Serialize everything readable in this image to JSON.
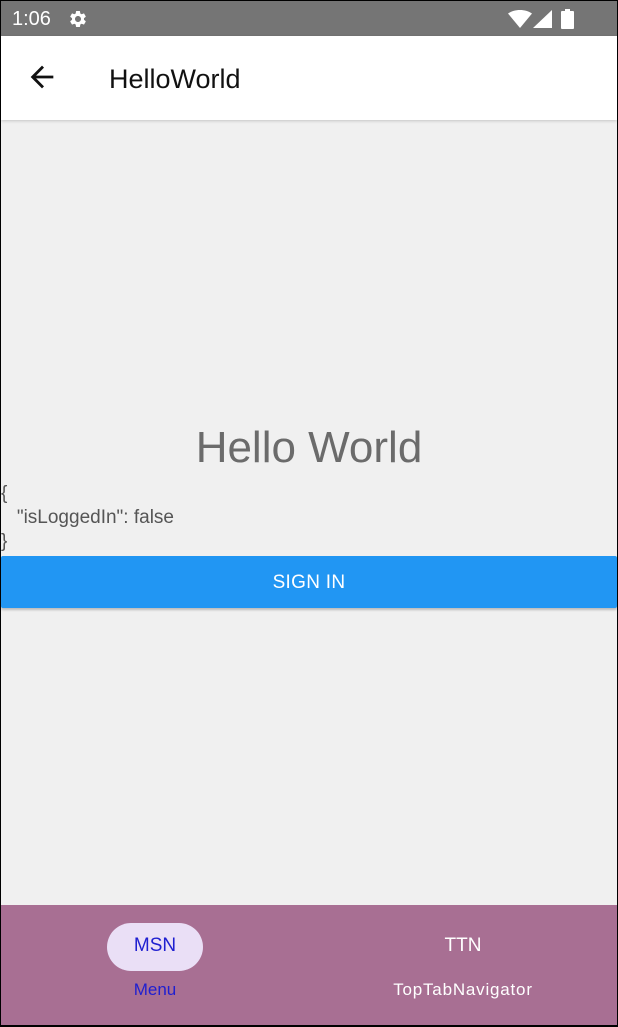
{
  "status_bar": {
    "time": "1:06",
    "icons": [
      "gear-icon",
      "wifi-icon",
      "signal-icon",
      "battery-icon"
    ]
  },
  "app_bar": {
    "back_icon": "arrow-left-icon",
    "title": "HelloWorld"
  },
  "content": {
    "greeting": "Hello World",
    "state_json": {
      "open": "{",
      "line": "   \"isLoggedIn\": false",
      "close": "}"
    },
    "sign_in_label": "SIGN IN"
  },
  "bottom_nav": {
    "items": [
      {
        "icon_text": "MSN",
        "label": "Menu",
        "selected": true
      },
      {
        "icon_text": "TTN",
        "label": "TopTabNavigator",
        "selected": false
      }
    ]
  },
  "colors": {
    "status_bar": "#757575",
    "app_bar": "#ffffff",
    "background": "#f0f0f0",
    "button": "#2196f3",
    "bottom_nav": "#a86f93",
    "active_pill": "#eadff6",
    "active_text": "#1f1fd0"
  }
}
